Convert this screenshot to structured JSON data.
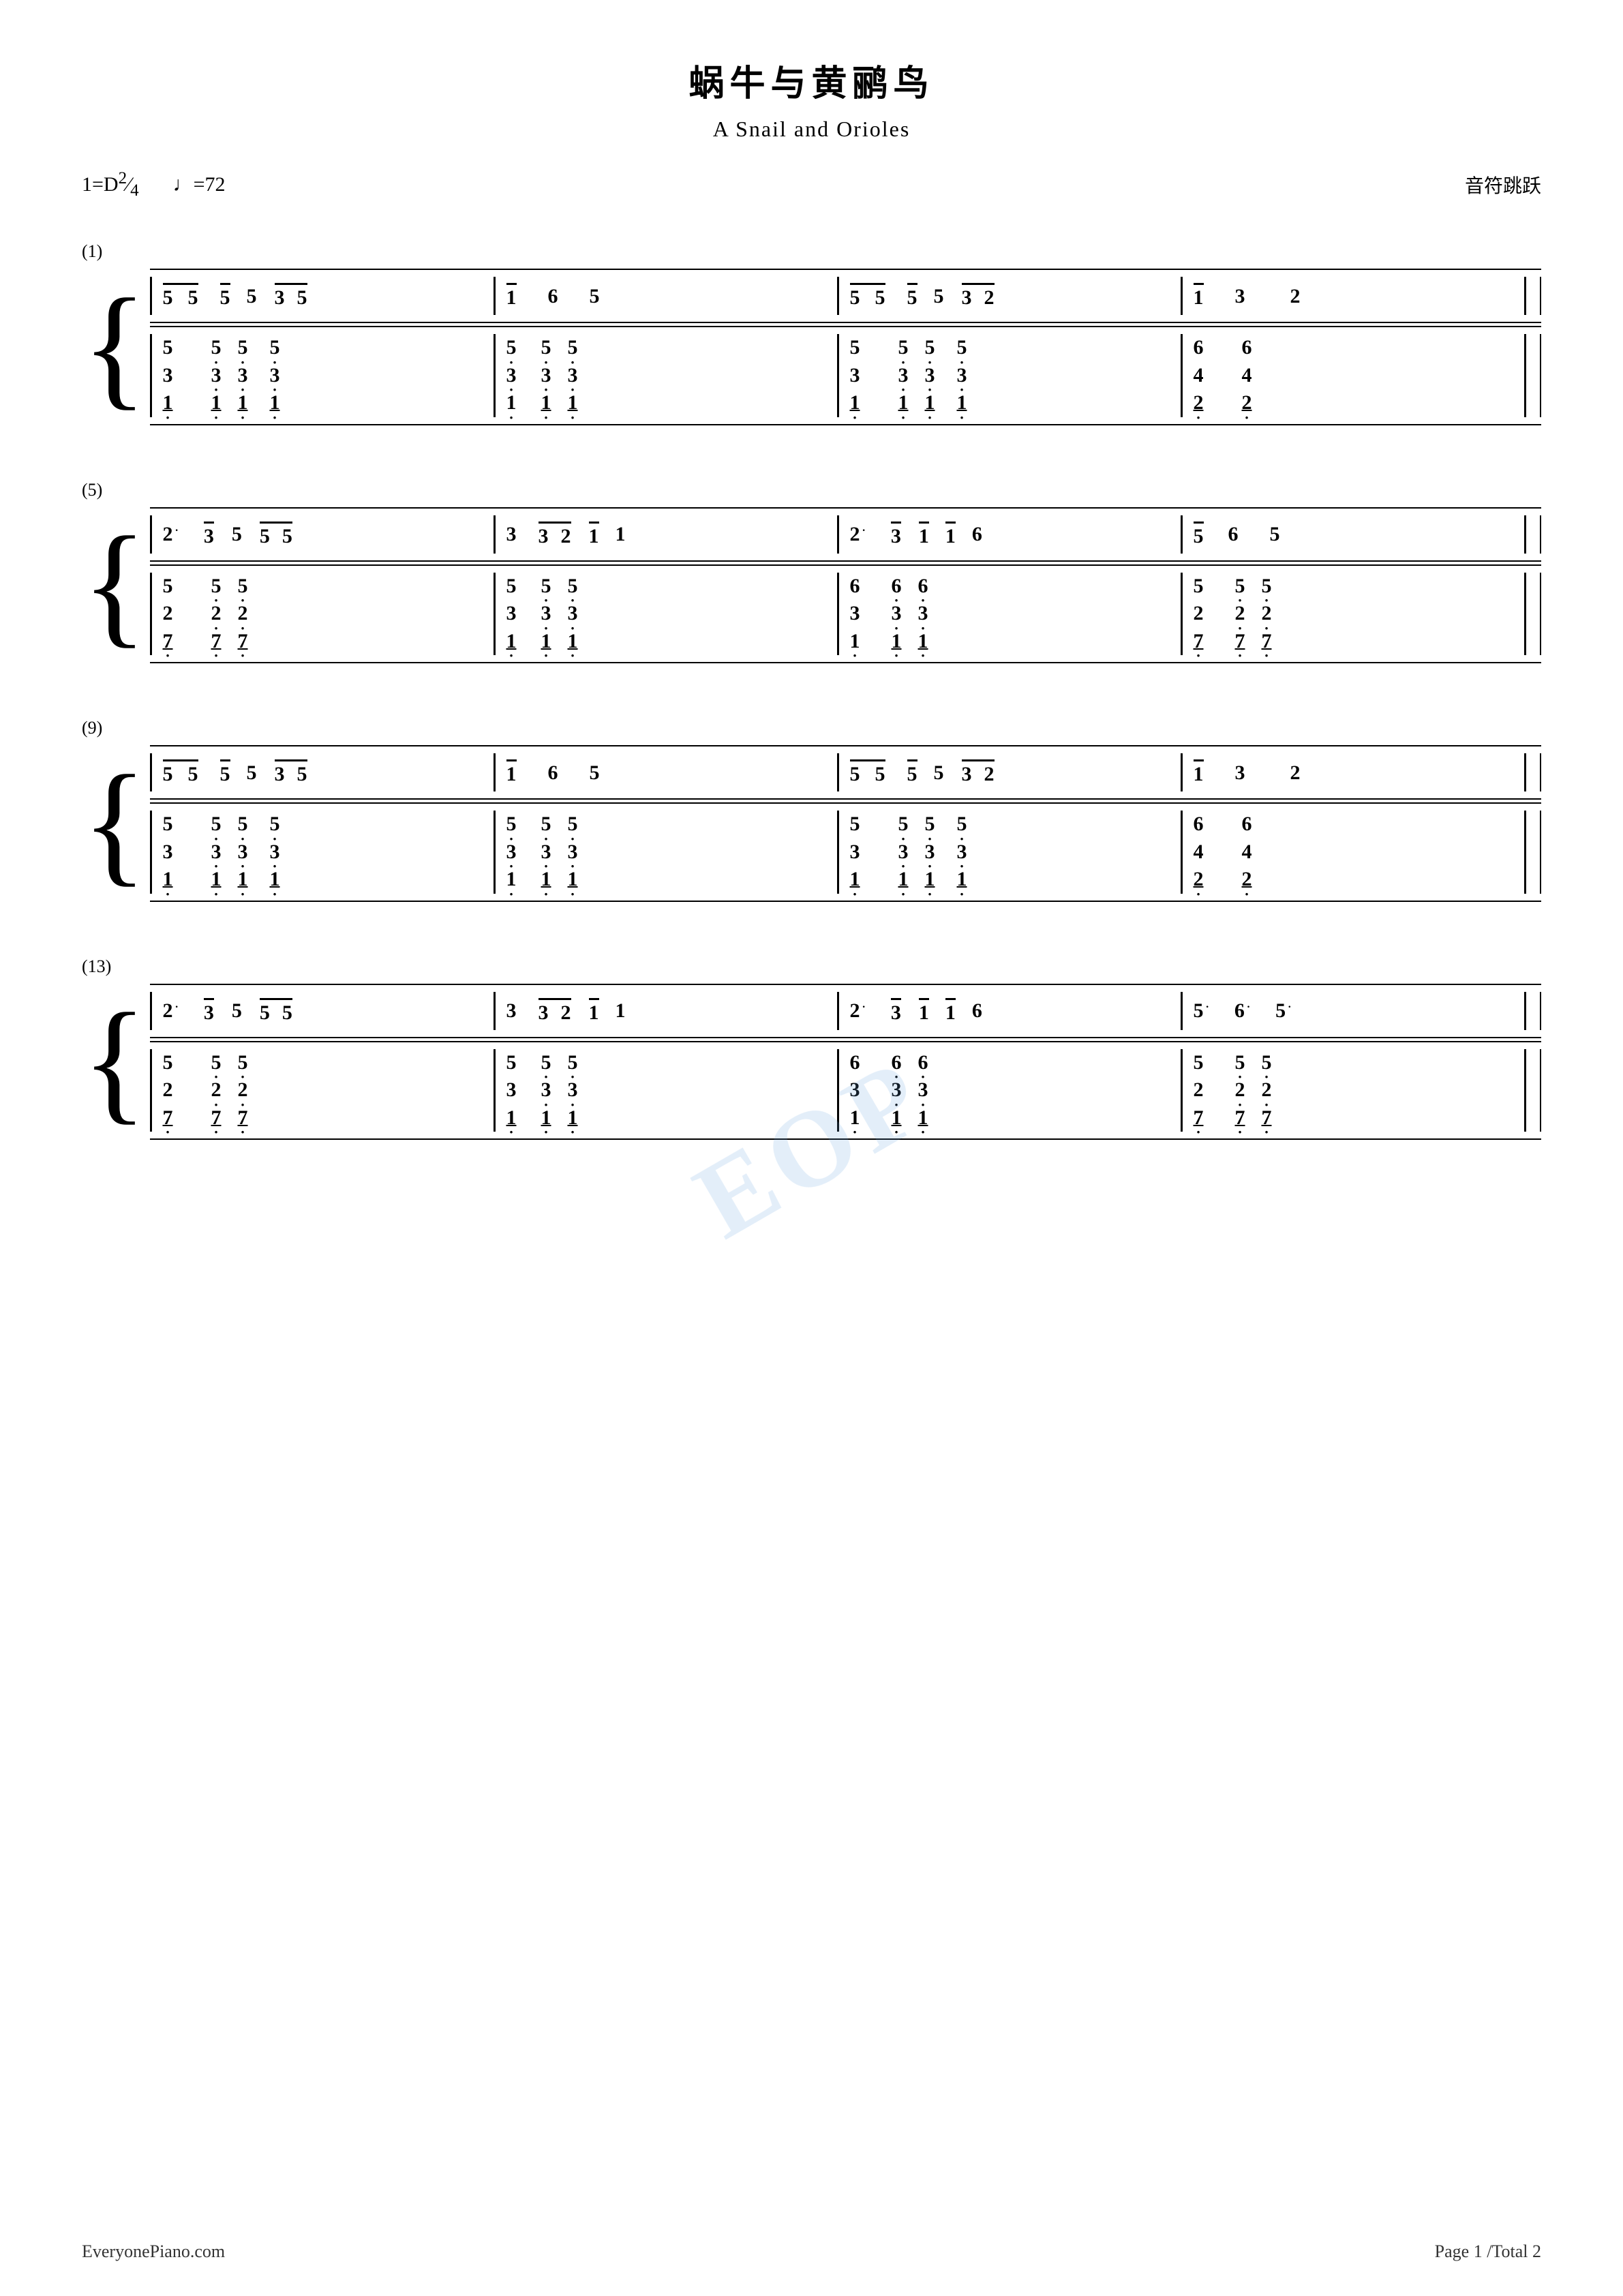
{
  "title": {
    "chinese": "蜗牛与黄鹂鸟",
    "english": "A Snail and Orioles"
  },
  "key": "1=D",
  "time_sig": "2/4",
  "tempo": "♩=72",
  "style": "音符跳跃",
  "watermark": "EOP",
  "footer": {
    "website": "EveryonePiano.com",
    "page": "Page 1 /Total 2"
  },
  "sections": [
    {
      "label": "(1)",
      "number": 1
    },
    {
      "label": "(5)",
      "number": 5
    },
    {
      "label": "(9)",
      "number": 9
    },
    {
      "label": "(13)",
      "number": 13
    }
  ]
}
